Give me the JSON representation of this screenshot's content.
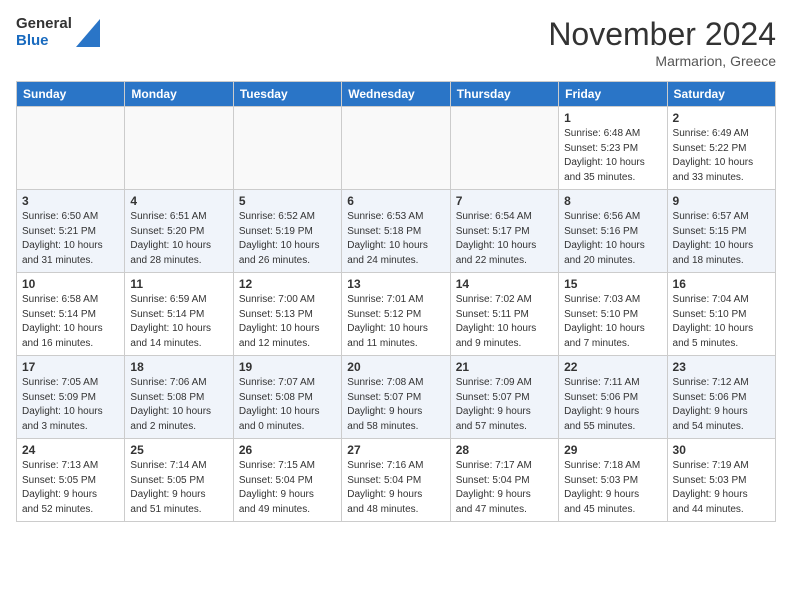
{
  "logo": {
    "general": "General",
    "blue": "Blue"
  },
  "header": {
    "month": "November 2024",
    "location": "Marmarion, Greece"
  },
  "weekdays": [
    "Sunday",
    "Monday",
    "Tuesday",
    "Wednesday",
    "Thursday",
    "Friday",
    "Saturday"
  ],
  "weeks": [
    [
      {
        "day": "",
        "info": "",
        "empty": true
      },
      {
        "day": "",
        "info": "",
        "empty": true
      },
      {
        "day": "",
        "info": "",
        "empty": true
      },
      {
        "day": "",
        "info": "",
        "empty": true
      },
      {
        "day": "",
        "info": "",
        "empty": true
      },
      {
        "day": "1",
        "info": "Sunrise: 6:48 AM\nSunset: 5:23 PM\nDaylight: 10 hours\nand 35 minutes.",
        "empty": false
      },
      {
        "day": "2",
        "info": "Sunrise: 6:49 AM\nSunset: 5:22 PM\nDaylight: 10 hours\nand 33 minutes.",
        "empty": false
      }
    ],
    [
      {
        "day": "3",
        "info": "Sunrise: 6:50 AM\nSunset: 5:21 PM\nDaylight: 10 hours\nand 31 minutes.",
        "empty": false
      },
      {
        "day": "4",
        "info": "Sunrise: 6:51 AM\nSunset: 5:20 PM\nDaylight: 10 hours\nand 28 minutes.",
        "empty": false
      },
      {
        "day": "5",
        "info": "Sunrise: 6:52 AM\nSunset: 5:19 PM\nDaylight: 10 hours\nand 26 minutes.",
        "empty": false
      },
      {
        "day": "6",
        "info": "Sunrise: 6:53 AM\nSunset: 5:18 PM\nDaylight: 10 hours\nand 24 minutes.",
        "empty": false
      },
      {
        "day": "7",
        "info": "Sunrise: 6:54 AM\nSunset: 5:17 PM\nDaylight: 10 hours\nand 22 minutes.",
        "empty": false
      },
      {
        "day": "8",
        "info": "Sunrise: 6:56 AM\nSunset: 5:16 PM\nDaylight: 10 hours\nand 20 minutes.",
        "empty": false
      },
      {
        "day": "9",
        "info": "Sunrise: 6:57 AM\nSunset: 5:15 PM\nDaylight: 10 hours\nand 18 minutes.",
        "empty": false
      }
    ],
    [
      {
        "day": "10",
        "info": "Sunrise: 6:58 AM\nSunset: 5:14 PM\nDaylight: 10 hours\nand 16 minutes.",
        "empty": false
      },
      {
        "day": "11",
        "info": "Sunrise: 6:59 AM\nSunset: 5:14 PM\nDaylight: 10 hours\nand 14 minutes.",
        "empty": false
      },
      {
        "day": "12",
        "info": "Sunrise: 7:00 AM\nSunset: 5:13 PM\nDaylight: 10 hours\nand 12 minutes.",
        "empty": false
      },
      {
        "day": "13",
        "info": "Sunrise: 7:01 AM\nSunset: 5:12 PM\nDaylight: 10 hours\nand 11 minutes.",
        "empty": false
      },
      {
        "day": "14",
        "info": "Sunrise: 7:02 AM\nSunset: 5:11 PM\nDaylight: 10 hours\nand 9 minutes.",
        "empty": false
      },
      {
        "day": "15",
        "info": "Sunrise: 7:03 AM\nSunset: 5:10 PM\nDaylight: 10 hours\nand 7 minutes.",
        "empty": false
      },
      {
        "day": "16",
        "info": "Sunrise: 7:04 AM\nSunset: 5:10 PM\nDaylight: 10 hours\nand 5 minutes.",
        "empty": false
      }
    ],
    [
      {
        "day": "17",
        "info": "Sunrise: 7:05 AM\nSunset: 5:09 PM\nDaylight: 10 hours\nand 3 minutes.",
        "empty": false
      },
      {
        "day": "18",
        "info": "Sunrise: 7:06 AM\nSunset: 5:08 PM\nDaylight: 10 hours\nand 2 minutes.",
        "empty": false
      },
      {
        "day": "19",
        "info": "Sunrise: 7:07 AM\nSunset: 5:08 PM\nDaylight: 10 hours\nand 0 minutes.",
        "empty": false
      },
      {
        "day": "20",
        "info": "Sunrise: 7:08 AM\nSunset: 5:07 PM\nDaylight: 9 hours\nand 58 minutes.",
        "empty": false
      },
      {
        "day": "21",
        "info": "Sunrise: 7:09 AM\nSunset: 5:07 PM\nDaylight: 9 hours\nand 57 minutes.",
        "empty": false
      },
      {
        "day": "22",
        "info": "Sunrise: 7:11 AM\nSunset: 5:06 PM\nDaylight: 9 hours\nand 55 minutes.",
        "empty": false
      },
      {
        "day": "23",
        "info": "Sunrise: 7:12 AM\nSunset: 5:06 PM\nDaylight: 9 hours\nand 54 minutes.",
        "empty": false
      }
    ],
    [
      {
        "day": "24",
        "info": "Sunrise: 7:13 AM\nSunset: 5:05 PM\nDaylight: 9 hours\nand 52 minutes.",
        "empty": false
      },
      {
        "day": "25",
        "info": "Sunrise: 7:14 AM\nSunset: 5:05 PM\nDaylight: 9 hours\nand 51 minutes.",
        "empty": false
      },
      {
        "day": "26",
        "info": "Sunrise: 7:15 AM\nSunset: 5:04 PM\nDaylight: 9 hours\nand 49 minutes.",
        "empty": false
      },
      {
        "day": "27",
        "info": "Sunrise: 7:16 AM\nSunset: 5:04 PM\nDaylight: 9 hours\nand 48 minutes.",
        "empty": false
      },
      {
        "day": "28",
        "info": "Sunrise: 7:17 AM\nSunset: 5:04 PM\nDaylight: 9 hours\nand 47 minutes.",
        "empty": false
      },
      {
        "day": "29",
        "info": "Sunrise: 7:18 AM\nSunset: 5:03 PM\nDaylight: 9 hours\nand 45 minutes.",
        "empty": false
      },
      {
        "day": "30",
        "info": "Sunrise: 7:19 AM\nSunset: 5:03 PM\nDaylight: 9 hours\nand 44 minutes.",
        "empty": false
      }
    ]
  ]
}
